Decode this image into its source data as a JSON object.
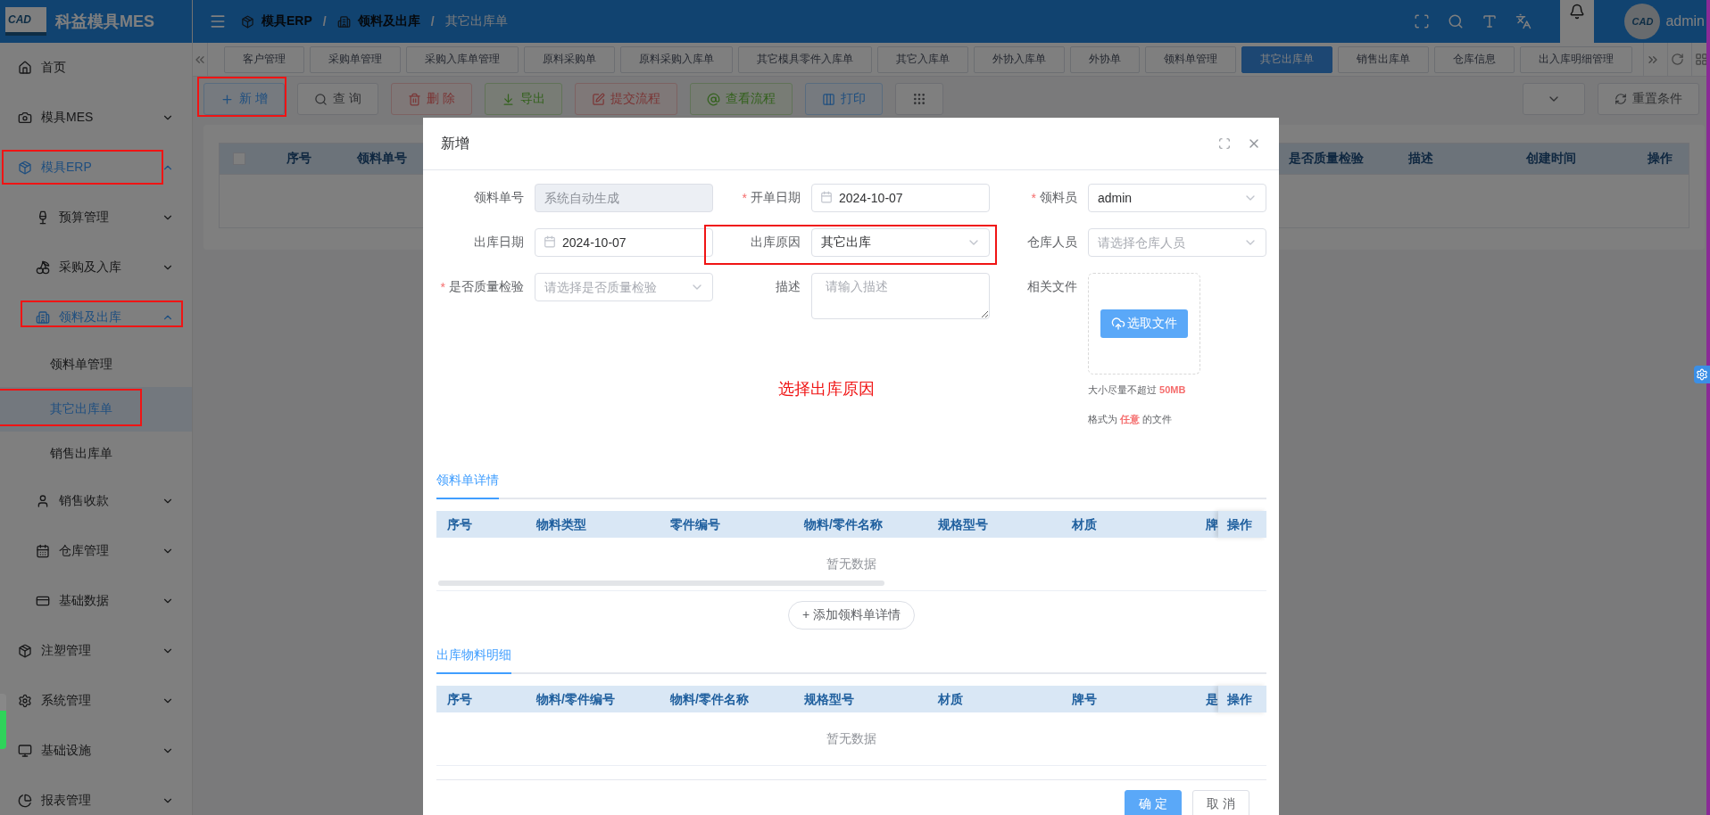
{
  "app": {
    "logo_text": "CAD",
    "name": "科益模具MES"
  },
  "sidebar": {
    "items": [
      {
        "label": "首页",
        "kind": "link",
        "active": false,
        "selected": false,
        "highlighted": false
      },
      {
        "label": "模具MES",
        "kind": "group",
        "expanded": false,
        "active": false,
        "selected": false,
        "highlighted": false
      },
      {
        "label": "模具ERP",
        "kind": "group",
        "expanded": true,
        "active": true,
        "selected": false,
        "highlighted": true,
        "children": [
          {
            "label": "预算管理",
            "kind": "group",
            "expanded": false,
            "active": false,
            "selected": false,
            "highlighted": false
          },
          {
            "label": "采购及入库",
            "kind": "group",
            "expanded": false,
            "active": false,
            "selected": false,
            "highlighted": false
          },
          {
            "label": "领料及出库",
            "kind": "group",
            "expanded": true,
            "active": true,
            "selected": false,
            "highlighted": true,
            "children": [
              {
                "label": "领料单管理",
                "kind": "link",
                "active": false,
                "selected": false,
                "highlighted": false
              },
              {
                "label": "其它出库单",
                "kind": "link",
                "active": true,
                "selected": true,
                "highlighted": true
              },
              {
                "label": "销售出库单",
                "kind": "link",
                "active": false,
                "selected": false,
                "highlighted": false
              }
            ]
          },
          {
            "label": "销售收款",
            "kind": "group",
            "expanded": false,
            "active": false,
            "selected": false,
            "highlighted": false
          },
          {
            "label": "仓库管理",
            "kind": "group",
            "expanded": false,
            "active": false,
            "selected": false,
            "highlighted": false
          },
          {
            "label": "基础数据",
            "kind": "group",
            "expanded": false,
            "active": false,
            "selected": false,
            "highlighted": false
          }
        ]
      },
      {
        "label": "注塑管理",
        "kind": "group",
        "expanded": false,
        "active": false,
        "selected": false,
        "highlighted": false
      },
      {
        "label": "系统管理",
        "kind": "group",
        "expanded": false,
        "active": false,
        "selected": false,
        "highlighted": false
      },
      {
        "label": "基础设施",
        "kind": "group",
        "expanded": false,
        "active": false,
        "selected": false,
        "highlighted": false
      },
      {
        "label": "报表管理",
        "kind": "group",
        "expanded": false,
        "active": false,
        "selected": false,
        "highlighted": false
      }
    ]
  },
  "header": {
    "breadcrumbs": [
      {
        "label": "模具ERP",
        "current": false
      },
      {
        "label": "领料及出库",
        "current": false
      },
      {
        "label": "其它出库单",
        "current": true
      }
    ],
    "separators": [
      "/",
      "/"
    ],
    "user": {
      "avatar_text": "CAD",
      "name": "admin"
    }
  },
  "tabs": {
    "items": [
      {
        "label": "客户管理",
        "selected": false
      },
      {
        "label": "采购单管理",
        "selected": false
      },
      {
        "label": "采购入库单管理",
        "selected": false
      },
      {
        "label": "原料采购单",
        "selected": false
      },
      {
        "label": "原料采购入库单",
        "selected": false
      },
      {
        "label": "其它模具零件入库单",
        "selected": false
      },
      {
        "label": "其它入库单",
        "selected": false
      },
      {
        "label": "外协入库单",
        "selected": false
      },
      {
        "label": "外协单",
        "selected": false
      },
      {
        "label": "领料单管理",
        "selected": false
      },
      {
        "label": "其它出库单",
        "selected": true
      },
      {
        "label": "销售出库单",
        "selected": false
      },
      {
        "label": "仓库信息",
        "selected": false
      },
      {
        "label": "出入库明细管理",
        "selected": false
      }
    ]
  },
  "toolbar": {
    "buttons": [
      {
        "label": "新 增",
        "kind": "primary",
        "highlighted": true
      },
      {
        "label": "查 询",
        "kind": "default",
        "highlighted": false
      },
      {
        "label": "删 除",
        "kind": "danger",
        "highlighted": false
      },
      {
        "label": "导出",
        "kind": "success",
        "highlighted": false
      },
      {
        "label": "提交流程",
        "kind": "danger",
        "highlighted": false
      },
      {
        "label": "查看流程",
        "kind": "success",
        "highlighted": false
      },
      {
        "label": "打印",
        "kind": "primary",
        "highlighted": false
      }
    ],
    "reset": "重置条件"
  },
  "table": {
    "select_all_checked": false,
    "left_columns": [
      "序号",
      "领料单号"
    ],
    "right_columns": [
      "是否质量检验",
      "描述",
      "创建时间",
      "操作"
    ]
  },
  "dialog": {
    "title": "新增",
    "fields": [
      {
        "label": "领料单号",
        "kind": "text",
        "placeholder": "系统自动生成",
        "disabled": true,
        "highlighted": false
      },
      {
        "label": "开单日期",
        "required_mark": "*",
        "kind": "date",
        "value": "2024-10-07",
        "disabled": false,
        "highlighted": false
      },
      {
        "label": "领料员",
        "required_mark": "*",
        "kind": "select",
        "value": "admin",
        "disabled": false,
        "highlighted": false
      },
      {
        "label": "出库日期",
        "kind": "date",
        "value": "2024-10-07",
        "disabled": false,
        "highlighted": false
      },
      {
        "label": "出库原因",
        "kind": "select",
        "value": "其它出库",
        "disabled": false,
        "highlighted": true
      },
      {
        "label": "仓库人员",
        "kind": "select",
        "placeholder": "请选择仓库人员",
        "disabled": false,
        "highlighted": false
      },
      {
        "label": "是否质量检验",
        "required_mark": "*",
        "kind": "select",
        "placeholder": "请选择是否质量检验",
        "disabled": false,
        "highlighted": false
      },
      {
        "label": "描述",
        "kind": "textarea",
        "placeholder": "请输入描述",
        "disabled": false,
        "highlighted": false
      },
      {
        "label": "相关文件",
        "kind": "upload",
        "button": "选取文件",
        "notes": [
          "大小尽量不超过 **50MB**",
          "格式为 **任意** 的文件"
        ],
        "disabled": false,
        "highlighted": false
      }
    ],
    "hint": "选择出库原因",
    "sections": [
      {
        "title": "领料单详情",
        "columns": [
          "序号",
          "物料类型",
          "零件编号",
          "物料/零件名称",
          "规格型号",
          "材质",
          "牌",
          "操作"
        ],
        "empty_text": "暂无数据",
        "has_scrollbar": true,
        "add_button": "+ 添加领料单详情"
      },
      {
        "title": "出库物料明细",
        "columns": [
          "序号",
          "物料/零件编号",
          "物料/零件名称",
          "规格型号",
          "材质",
          "牌号",
          "是",
          "操作"
        ],
        "empty_text": "暂无数据",
        "has_scrollbar": false
      }
    ],
    "buttons": [
      {
        "label": "确 定",
        "kind": "primary"
      },
      {
        "label": "取 消",
        "kind": "default"
      }
    ]
  }
}
